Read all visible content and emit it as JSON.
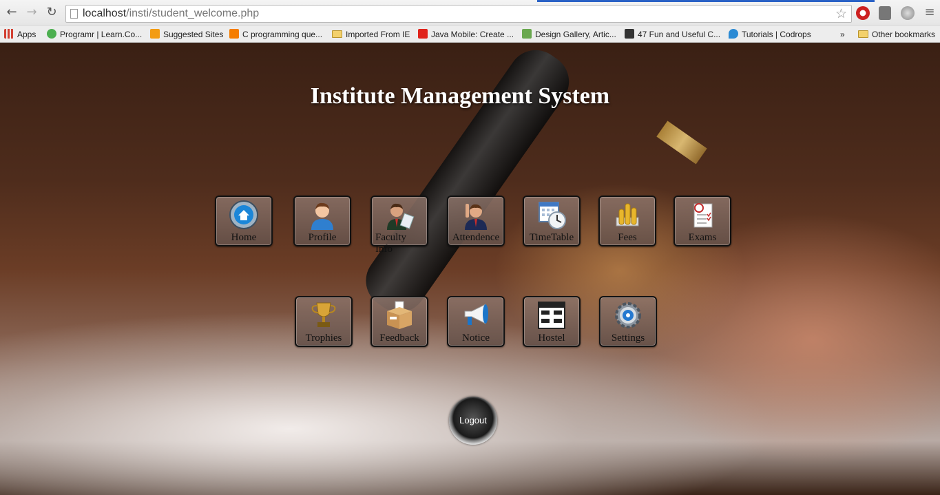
{
  "browser": {
    "url_host": "localhost",
    "url_path": "/insti/student_welcome.php",
    "bookmarks": [
      {
        "label": "Apps",
        "icon": "apps-grid-icon",
        "color": "#d23f31"
      },
      {
        "label": "Programr | Learn.Co...",
        "icon": "programr-icon",
        "color": "#4caf50"
      },
      {
        "label": "Suggested Sites",
        "icon": "suggested-sites-icon",
        "color": "#f39c12"
      },
      {
        "label": "C programming que...",
        "icon": "blogger-icon",
        "color": "#f57d00"
      },
      {
        "label": "Imported From IE",
        "icon": "folder-icon",
        "color": "#f3d16c"
      },
      {
        "label": "Java Mobile: Create ...",
        "icon": "oracle-icon",
        "color": "#e0231b"
      },
      {
        "label": "Design Gallery, Artic...",
        "icon": "design-gallery-icon",
        "color": "#6aa84f"
      },
      {
        "label": "47 Fun and Useful C...",
        "icon": "tutorial-site-icon",
        "color": "#333333"
      },
      {
        "label": "Tutorials | Codrops",
        "icon": "codrops-icon",
        "color": "#2a8ad4"
      },
      {
        "label": "»",
        "icon": "overflow-chevron-icon",
        "color": "#444444"
      },
      {
        "label": "Other bookmarks",
        "icon": "folder-icon",
        "color": "#f3d16c"
      }
    ]
  },
  "page": {
    "title": "Institute Management System",
    "row1": [
      {
        "label": "Home",
        "icon": "home-icon"
      },
      {
        "label": "Profile",
        "icon": "user-profile-icon"
      },
      {
        "label": "Faculty Info",
        "icon": "faculty-icon"
      },
      {
        "label": "Attendence",
        "icon": "attendance-icon"
      },
      {
        "label": "TimeTable",
        "icon": "calendar-clock-icon"
      },
      {
        "label": "Fees",
        "icon": "coins-icon"
      },
      {
        "label": "Exams",
        "icon": "exam-sheet-icon"
      }
    ],
    "row2": [
      {
        "label": "Trophies",
        "icon": "trophy-icon"
      },
      {
        "label": "Feedback",
        "icon": "feedback-box-icon"
      },
      {
        "label": "Notice",
        "icon": "megaphone-icon"
      },
      {
        "label": "Hostel",
        "icon": "hostel-beds-icon"
      },
      {
        "label": "Settings",
        "icon": "gear-icon"
      }
    ],
    "logout_label": "Logout"
  }
}
